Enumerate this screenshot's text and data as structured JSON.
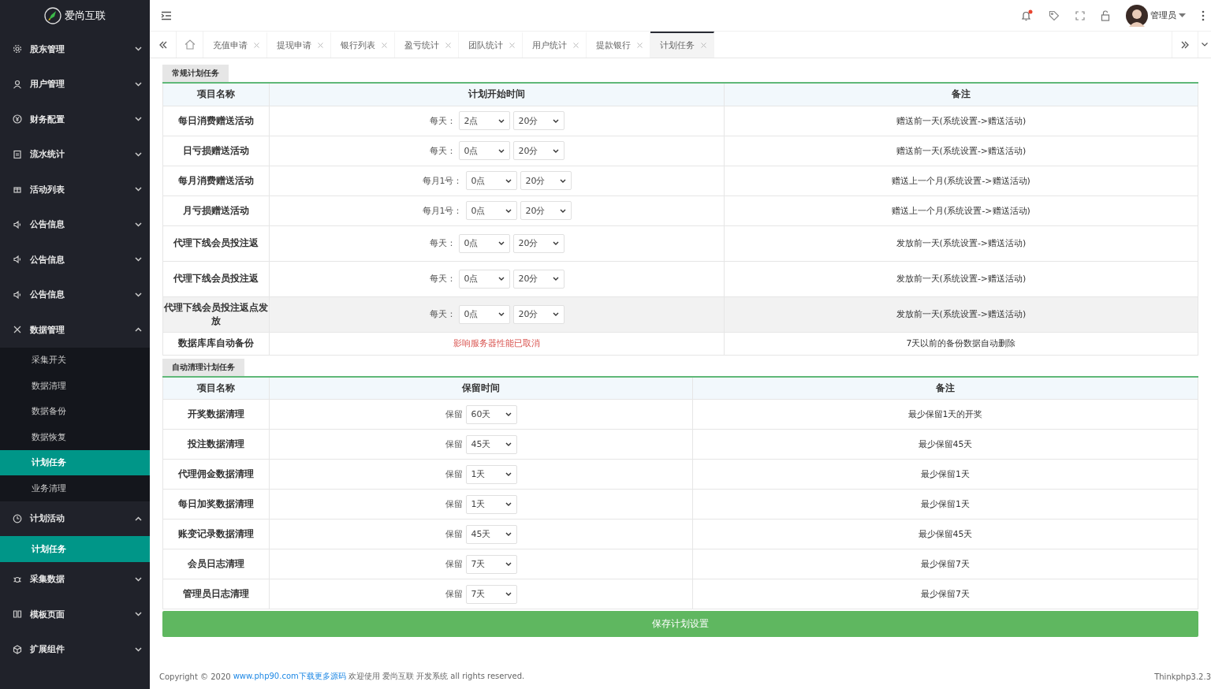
{
  "brand": {
    "name": "爱尚互联"
  },
  "sidebar": {
    "items": [
      {
        "label": "股东管理",
        "expanded": false
      },
      {
        "label": "用户管理",
        "expanded": false
      },
      {
        "label": "财务配置",
        "expanded": false
      },
      {
        "label": "流水统计",
        "expanded": false
      },
      {
        "label": "活动列表",
        "expanded": false
      },
      {
        "label": "公告信息",
        "expanded": false
      },
      {
        "label": "公告信息",
        "expanded": false
      },
      {
        "label": "公告信息",
        "expanded": false
      },
      {
        "label": "数据管理",
        "expanded": true,
        "children": [
          {
            "label": "采集开关",
            "selected": false
          },
          {
            "label": "数据清理",
            "selected": false
          },
          {
            "label": "数据备份",
            "selected": false
          },
          {
            "label": "数据恢复",
            "selected": false
          },
          {
            "label": "计划任务",
            "selected": true
          },
          {
            "label": "业务清理",
            "selected": false
          }
        ]
      },
      {
        "label": "计划活动",
        "expanded": true,
        "children": [
          {
            "label": "计划任务",
            "selected": true
          }
        ]
      },
      {
        "label": "采集数据",
        "expanded": false
      },
      {
        "label": "模板页面",
        "expanded": false
      },
      {
        "label": "扩展组件",
        "expanded": false
      }
    ]
  },
  "header": {
    "notification_dot": true,
    "user": "管理员"
  },
  "tabs": [
    {
      "label": "充值申请",
      "selected": false
    },
    {
      "label": "提现申请",
      "selected": false
    },
    {
      "label": "银行列表",
      "selected": false
    },
    {
      "label": "盈亏统计",
      "selected": false
    },
    {
      "label": "团队统计",
      "selected": false
    },
    {
      "label": "用户统计",
      "selected": false
    },
    {
      "label": "提款银行",
      "selected": false
    },
    {
      "label": "计划任务",
      "selected": true
    }
  ],
  "regular_tasks": {
    "title": "常规计划任务",
    "columns": [
      "项目名称",
      "计划开始时间",
      "备注"
    ],
    "rows": [
      {
        "name": "每日消费赠送活动",
        "prefix": "每天：",
        "hour": "2点",
        "minute": "20分",
        "note": "赠送前一天(系统设置->赠送活动)",
        "highlighted": false
      },
      {
        "name": "日亏损赠送活动",
        "prefix": "每天：",
        "hour": "0点",
        "minute": "20分",
        "note": "赠送前一天(系统设置->赠送活动)",
        "highlighted": false
      },
      {
        "name": "每月消费赠送活动",
        "prefix": "每月1号：",
        "hour": "0点",
        "minute": "20分",
        "note": "赠送上一个月(系统设置->赠送活动)",
        "highlighted": false
      },
      {
        "name": "月亏损赠送活动",
        "prefix": "每月1号：",
        "hour": "0点",
        "minute": "20分",
        "note": "赠送上一个月(系统设置->赠送活动)",
        "highlighted": false
      },
      {
        "name": "代理下线会员投注返",
        "prefix": "每天：",
        "hour": "0点",
        "minute": "20分",
        "note": "发放前一天(系统设置->赠送活动)",
        "highlighted": false
      },
      {
        "name": "代理下线会员投注返",
        "prefix": "每天：",
        "hour": "0点",
        "minute": "20分",
        "note": "发放前一天(系统设置->赠送活动)",
        "highlighted": false
      },
      {
        "name": "代理下线会员投注返点发放",
        "prefix": "每天：",
        "hour": "0点",
        "minute": "20分",
        "note": "发放前一天(系统设置->赠送活动)",
        "highlighted": true
      },
      {
        "name": "数据库库自动备份",
        "warning": "影响服务器性能已取消",
        "note": "7天以前的备份数据自动删除",
        "highlighted": false
      }
    ]
  },
  "cleanup_tasks": {
    "title": "自动清理计划任务",
    "columns": [
      "项目名称",
      "保留时间",
      "备注"
    ],
    "rows": [
      {
        "name": "开奖数据清理",
        "prefix": "保留",
        "value": "60天",
        "note": "最少保留1天的开奖"
      },
      {
        "name": "投注数据清理",
        "prefix": "保留",
        "value": "45天",
        "note": "最少保留45天"
      },
      {
        "name": "代理佣金数据清理",
        "prefix": "保留",
        "value": "1天",
        "note": "最少保留1天"
      },
      {
        "name": "每日加奖数据清理",
        "prefix": "保留",
        "value": "1天",
        "note": "最少保留1天"
      },
      {
        "name": "账变记录数据清理",
        "prefix": "保留",
        "value": "45天",
        "note": "最少保留45天"
      },
      {
        "name": "会员日志清理",
        "prefix": "保留",
        "value": "7天",
        "note": "最少保留7天"
      },
      {
        "name": "管理员日志清理",
        "prefix": "保留",
        "value": "7天",
        "note": "最少保留7天"
      }
    ]
  },
  "save_button": "保存计划设置",
  "footer": {
    "copyright": "Copyright © 2020",
    "link": "www.php90.com下载更多源码",
    "text": "欢迎使用 爱尚互联 开发系统 all rights reserved.",
    "version": "Thinkphp3.2.3"
  }
}
